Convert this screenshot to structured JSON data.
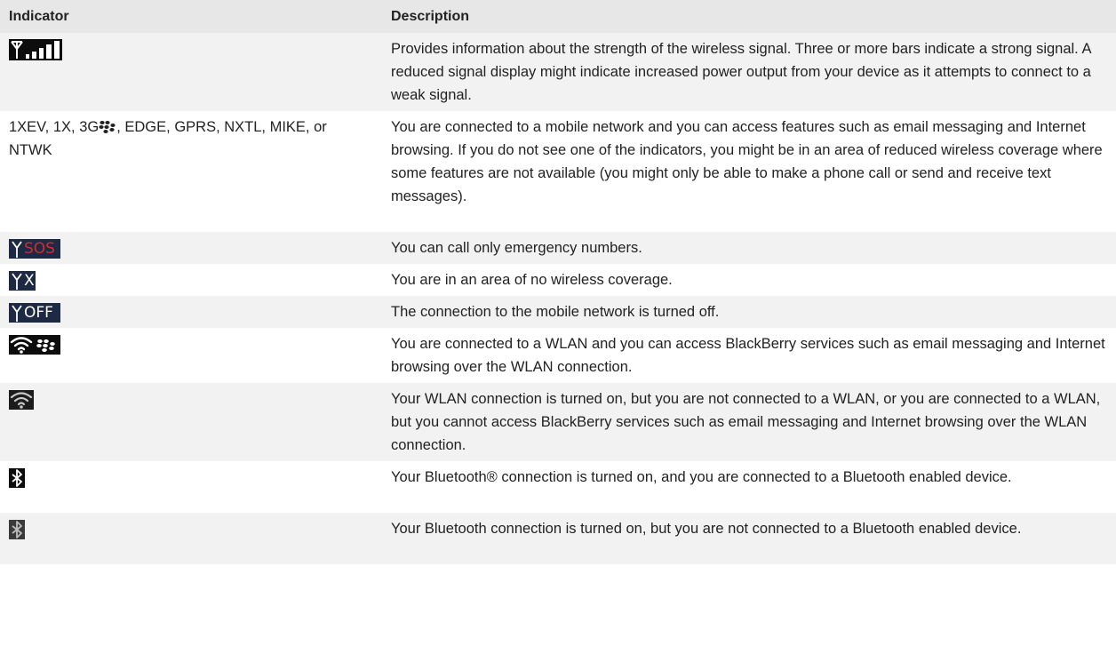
{
  "table": {
    "header": {
      "indicator": "Indicator",
      "description": "Description"
    },
    "rows": [
      {
        "icon": "signal-strength-icon",
        "description": "Provides information about the strength of the wireless signal. Three or more bars indicate a strong signal. A reduced signal display might indicate increased power output from your device as it attempts to connect to a weak signal."
      },
      {
        "indicator_text_before": "1XEV, 1X, 3G",
        "indicator_text_after": ", EDGE, GPRS, NXTL, MIKE, or NTWK",
        "description": "You are connected to a mobile network and you can access features such as email messaging and Internet browsing. If you do not see one of the indicators, you might be in an area of reduced wireless coverage where some features are not available (you might only be able to make a phone call or send and receive text messages)."
      },
      {
        "icon": "sos-icon",
        "icon_text": "SOS",
        "description": "You can call only emergency numbers."
      },
      {
        "icon": "no-coverage-icon",
        "icon_text": "X",
        "description": "You are in an area of no wireless coverage."
      },
      {
        "icon": "radio-off-icon",
        "icon_text": "OFF",
        "description": "The connection to the mobile network is turned off."
      },
      {
        "icon": "wlan-blackberry-icon",
        "description": "You are connected to a WLAN and you can access BlackBerry services such as email messaging and Internet browsing over the WLAN connection."
      },
      {
        "icon": "wlan-icon",
        "description": "Your WLAN connection is turned on, but you are not connected to a WLAN, or you are connected to a WLAN, but you cannot access BlackBerry services such as email messaging and Internet browsing over the WLAN connection."
      },
      {
        "icon": "bluetooth-connected-icon",
        "description": "Your Bluetooth® connection is turned on, and you are connected to a Bluetooth enabled device."
      },
      {
        "icon": "bluetooth-on-icon",
        "description": "Your Bluetooth connection is turned on, but you are not connected to a Bluetooth enabled device."
      }
    ]
  },
  "colors": {
    "header_bg": "#e7e7e7",
    "alt_row_bg": "#f2f2f2",
    "icon_navy": "#1e2a44",
    "sos_red": "#d42a34"
  }
}
